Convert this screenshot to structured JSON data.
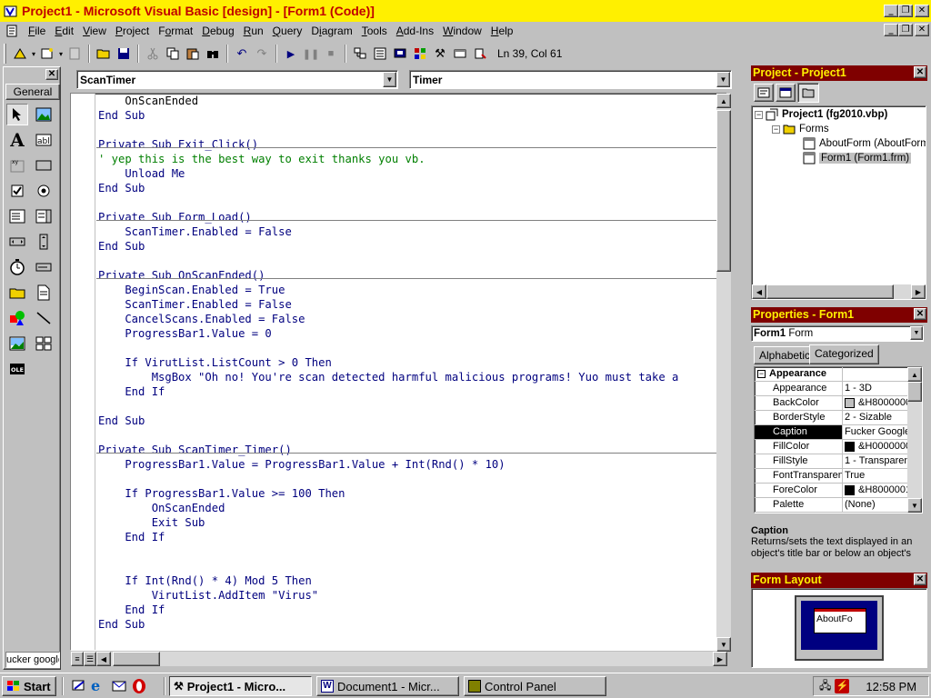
{
  "window": {
    "title": "Project1 - Microsoft Visual Basic [design] - [Form1 (Code)]",
    "controls": {
      "minimize": "_",
      "restore": "❐",
      "close": "✕"
    }
  },
  "menu": [
    {
      "label": "File",
      "accel": "F",
      "rest": "ile"
    },
    {
      "label": "Edit",
      "accel": "E",
      "rest": "dit"
    },
    {
      "label": "View",
      "accel": "V",
      "rest": "iew"
    },
    {
      "label": "Project",
      "accel": "P",
      "rest": "roject"
    },
    {
      "label": "Format",
      "accel": "o",
      "pre": "F",
      "rest": "rmat"
    },
    {
      "label": "Debug",
      "accel": "D",
      "rest": "ebug"
    },
    {
      "label": "Run",
      "accel": "R",
      "rest": "un"
    },
    {
      "label": "Query",
      "accel": "Q",
      "rest": "uery"
    },
    {
      "label": "Diagram",
      "accel": "i",
      "pre": "D",
      "rest": "agram"
    },
    {
      "label": "Tools",
      "accel": "T",
      "rest": "ools"
    },
    {
      "label": "Add-Ins",
      "accel": "A",
      "rest": "dd-Ins"
    },
    {
      "label": "Window",
      "accel": "W",
      "rest": "indow"
    },
    {
      "label": "Help",
      "accel": "H",
      "rest": "elp"
    }
  ],
  "toolbar": {
    "status": "Ln 39, Col 61"
  },
  "toolbox": {
    "tab": "General",
    "status_label": "ucker google"
  },
  "code": {
    "object_combo": "ScanTimer",
    "proc_combo": "Timer",
    "lines": [
      {
        "text": "    OnScanEnded",
        "type": "txt"
      },
      {
        "text": "End Sub",
        "type": "kw"
      },
      {
        "text": "",
        "type": "txt"
      },
      {
        "text": "Private Sub Exit_Click()",
        "type": "kw"
      },
      {
        "text": "' yep this is the best way to exit thanks you vb.",
        "type": "com"
      },
      {
        "text": "    Unload Me",
        "type": "kw"
      },
      {
        "text": "End Sub",
        "type": "kw"
      },
      {
        "text": "",
        "type": "txt"
      },
      {
        "text": "Private Sub Form_Load()",
        "type": "kw"
      },
      {
        "text": "    ScanTimer.Enabled = False",
        "type": "kw"
      },
      {
        "text": "End Sub",
        "type": "kw"
      },
      {
        "text": "",
        "type": "txt"
      },
      {
        "text": "Private Sub OnScanEnded()",
        "type": "kw"
      },
      {
        "text": "    BeginScan.Enabled = True",
        "type": "kw"
      },
      {
        "text": "    ScanTimer.Enabled = False",
        "type": "kw"
      },
      {
        "text": "    CancelScans.Enabled = False",
        "type": "kw"
      },
      {
        "text": "    ProgressBar1.Value = 0",
        "type": "kw"
      },
      {
        "text": "",
        "type": "txt"
      },
      {
        "text": "    If VirutList.ListCount > 0 Then",
        "type": "kw"
      },
      {
        "text": "        MsgBox \"Oh no! You're scan detected harmful malicious programs! Yuo must take a",
        "type": "kw"
      },
      {
        "text": "    End If",
        "type": "kw"
      },
      {
        "text": "",
        "type": "txt"
      },
      {
        "text": "End Sub",
        "type": "kw"
      },
      {
        "text": "",
        "type": "txt"
      },
      {
        "text": "Private Sub ScanTimer_Timer()",
        "type": "kw"
      },
      {
        "text": "    ProgressBar1.Value = ProgressBar1.Value + Int(Rnd() * 10)",
        "type": "kw"
      },
      {
        "text": "",
        "type": "txt"
      },
      {
        "text": "    If ProgressBar1.Value >= 100 Then",
        "type": "kw"
      },
      {
        "text": "        OnScanEnded",
        "type": "kw"
      },
      {
        "text": "        Exit Sub",
        "type": "kw"
      },
      {
        "text": "    End If",
        "type": "kw"
      },
      {
        "text": "",
        "type": "txt"
      },
      {
        "text": "",
        "type": "txt"
      },
      {
        "text": "    If Int(Rnd() * 4) Mod 5 Then",
        "type": "kw"
      },
      {
        "text": "        VirutList.AddItem \"Virus\"",
        "type": "kw"
      },
      {
        "text": "    End If",
        "type": "kw"
      },
      {
        "text": "End Sub",
        "type": "kw"
      }
    ]
  },
  "project": {
    "title": "Project - Project1",
    "root": "Project1 (fg2010.vbp)",
    "folder": "Forms",
    "items": [
      "AboutForm (AboutForm",
      "Form1 (Form1.frm)"
    ]
  },
  "properties": {
    "title": "Properties - Form1",
    "object_name": "Form1",
    "object_type": "Form",
    "tabs": [
      "Alphabetic",
      "Categorized"
    ],
    "category": "Appearance",
    "rows": [
      {
        "name": "Appearance",
        "value": "1 - 3D",
        "swatch": ""
      },
      {
        "name": "BackColor",
        "value": "&H8000000",
        "swatch": "#c0c0c0"
      },
      {
        "name": "BorderStyle",
        "value": "2 - Sizable",
        "swatch": ""
      },
      {
        "name": "Caption",
        "value": "Fucker Google",
        "swatch": "",
        "selected": true
      },
      {
        "name": "FillColor",
        "value": "&H0000000",
        "swatch": "#000000"
      },
      {
        "name": "FillStyle",
        "value": "1 - Transparen",
        "swatch": ""
      },
      {
        "name": "FontTransparen",
        "value": "True",
        "swatch": ""
      },
      {
        "name": "ForeColor",
        "value": "&H8000001",
        "swatch": "#000000"
      },
      {
        "name": "Palette",
        "value": "(None)",
        "swatch": ""
      }
    ],
    "desc_title": "Caption",
    "desc_text": "Returns/sets the text displayed in an object's title bar or below an object's"
  },
  "layout": {
    "title": "Form Layout",
    "form_label": "AboutFo"
  },
  "taskbar": {
    "start": "Start",
    "tasks": [
      "Project1 - Micro...",
      "Document1 - Micr...",
      "Control Panel"
    ],
    "clock": "12:58 PM"
  },
  "colors": {
    "title_bg": "#fff000",
    "title_fg": "#c00000",
    "panel_title_bg": "#7f0000",
    "panel_title_fg": "#fff000",
    "keyword": "#00007f",
    "comment": "#007f00"
  }
}
